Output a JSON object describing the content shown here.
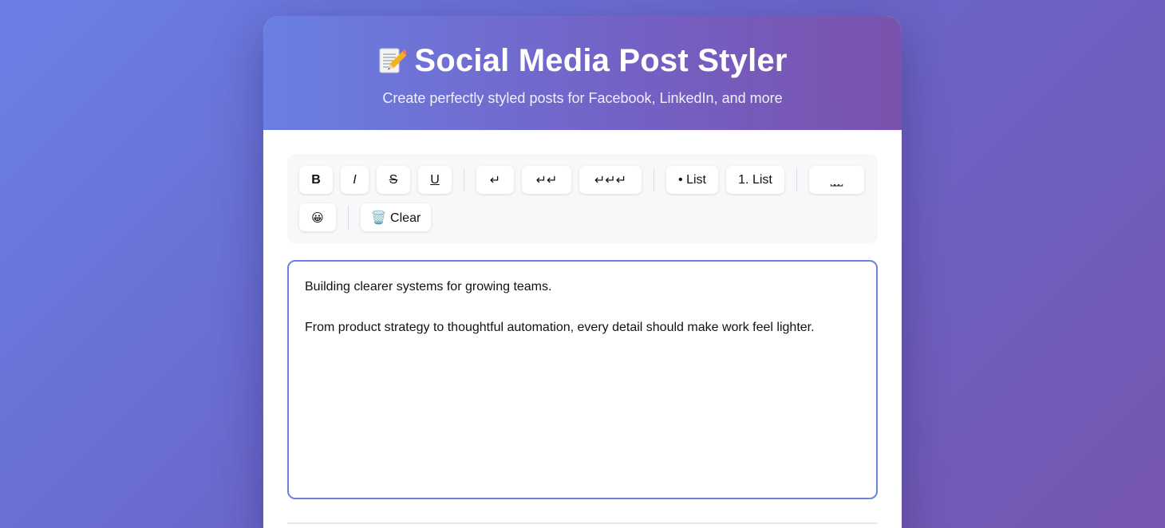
{
  "header": {
    "title_icon": "memo-pencil-icon",
    "title": "Social Media Post Styler",
    "subtitle": "Create perfectly styled posts for Facebook, LinkedIn, and more"
  },
  "toolbar": {
    "bold": "B",
    "italic": "I",
    "strikethrough": "S",
    "underline": "U",
    "line_break_1": "↵",
    "line_break_2": "↵↵",
    "line_break_3": "↵↵↵",
    "bullet_list": "• List",
    "numbered_list": "1. List",
    "spaces": "⎵⎵⎵",
    "emoji": "😀",
    "clear": "🗑️ Clear"
  },
  "editor": {
    "paragraphs": [
      "Building clearer systems for growing teams.",
      "From product strategy to thoughtful automation, every detail should make work feel lighter."
    ]
  },
  "colors": {
    "background_start": "#6b7fe6",
    "background_end": "#7656b0",
    "editor_border": "#6b82df",
    "toolbar_bg": "#f7f8fa"
  }
}
